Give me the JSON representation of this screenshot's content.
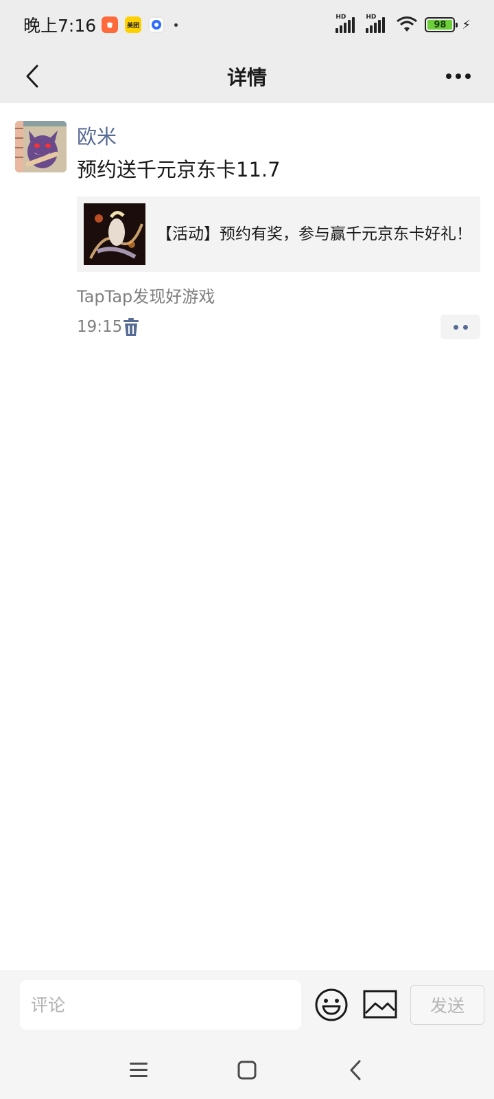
{
  "status_bar": {
    "time": "晚上7:16",
    "app_icons": [
      "taobao-icon",
      "meituan-icon",
      "circle-app-icon"
    ],
    "meituan_label": "美团",
    "signal1_label": "HD",
    "signal2_label": "HD",
    "battery_level": "98"
  },
  "nav": {
    "title": "详情"
  },
  "post": {
    "author": "欧米",
    "text": "预约送千元京东卡11.7",
    "link_title": "【活动】预约有奖，参与赢千元京东卡好礼！",
    "source": "TapTap发现好游戏",
    "time": "19:15"
  },
  "comment_bar": {
    "placeholder": "评论",
    "send_label": "发送"
  },
  "colors": {
    "link_blue": "#576b95",
    "bar_bg": "#ededed",
    "muted": "#7f7f7f"
  }
}
